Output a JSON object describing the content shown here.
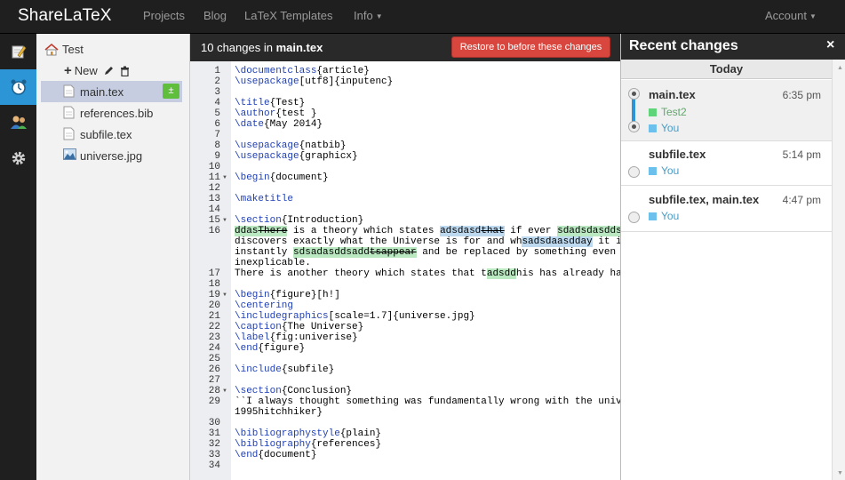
{
  "topbar": {
    "brand": "ShareLaTeX",
    "nav": [
      "Projects",
      "Blog",
      "LaTeX Templates",
      "Info"
    ],
    "account": "Account",
    "bg_color": "#1f1f1f"
  },
  "leftbar": {
    "icons": [
      "edit-icon",
      "history-icon",
      "users-icon",
      "settings-icon"
    ],
    "active_color": "#2b95d6"
  },
  "filetree": {
    "root": "Test",
    "new_label": "New",
    "files": [
      {
        "name": "main.tex",
        "icon": "file-icon",
        "selected": true
      },
      {
        "name": "references.bib",
        "icon": "file-icon"
      },
      {
        "name": "subfile.tex",
        "icon": "file-icon"
      },
      {
        "name": "universe.jpg",
        "icon": "image-icon"
      }
    ],
    "badge": "±"
  },
  "diff": {
    "count_text": "10 changes in",
    "file": "main.tex",
    "restore_button": "Restore to before these changes",
    "line_numbers": [
      "1",
      "2",
      "3",
      "4",
      "5",
      "6",
      "7",
      "8",
      "9",
      "10",
      "11",
      "12",
      "13",
      "14",
      "15",
      "16",
      "",
      "",
      "",
      "17",
      "18",
      "19",
      "20",
      "21",
      "22",
      "23",
      "24",
      "25",
      "26",
      "27",
      "28",
      "29",
      "",
      "30",
      "31",
      "32",
      "33",
      "34"
    ]
  },
  "recent": {
    "title": "Recent changes",
    "close": "×",
    "day": "Today",
    "entries": [
      {
        "files": "main.tex",
        "time": "6:35 pm",
        "users": [
          {
            "name": "Test2",
            "color": "#5fd478"
          },
          {
            "name": "You",
            "color": "#6cc1ec"
          }
        ]
      },
      {
        "files": "subfile.tex",
        "time": "5:14 pm",
        "users": [
          {
            "name": "You",
            "color": "#6cc1ec"
          }
        ]
      },
      {
        "files": "subfile.tex, main.tex",
        "time": "4:47 pm",
        "users": [
          {
            "name": "You",
            "color": "#6cc1ec"
          }
        ]
      }
    ]
  }
}
